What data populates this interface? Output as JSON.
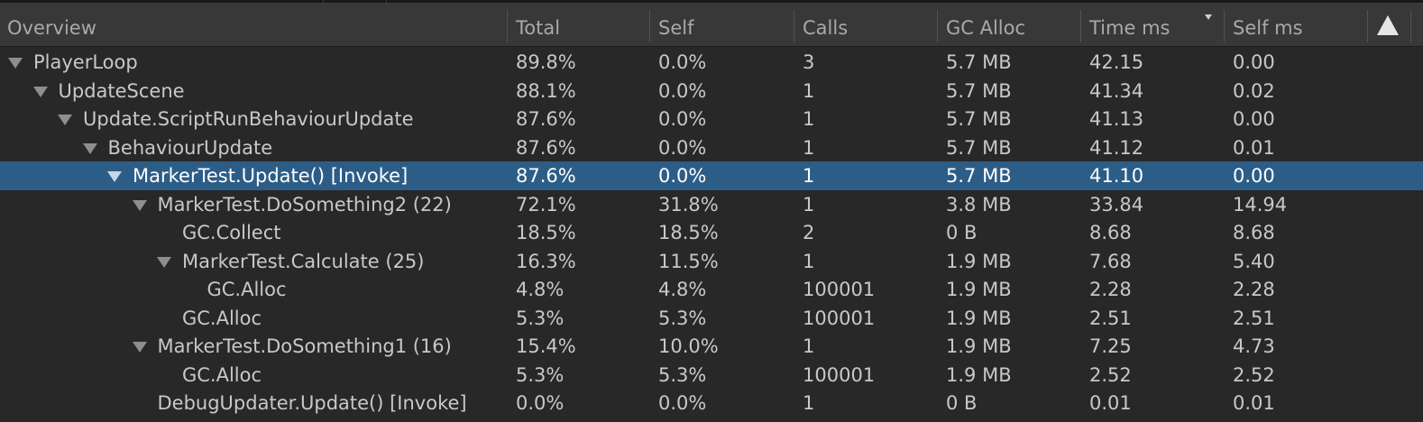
{
  "columns": [
    {
      "label": "Overview"
    },
    {
      "label": "Total"
    },
    {
      "label": "Self"
    },
    {
      "label": "Calls"
    },
    {
      "label": "GC Alloc"
    },
    {
      "label": "Time ms",
      "sorted": true,
      "sort_direction": "descending"
    },
    {
      "label": "Self ms"
    }
  ],
  "header_warning_icon": "warning-triangle-icon",
  "rows": [
    {
      "name": "PlayerLoop",
      "depth": 0,
      "expanded": true,
      "total": "89.8%",
      "self": "0.0%",
      "calls": "3",
      "gc_alloc": "5.7 MB",
      "time_ms": "42.15",
      "self_ms": "0.00"
    },
    {
      "name": "UpdateScene",
      "depth": 1,
      "expanded": true,
      "total": "88.1%",
      "self": "0.0%",
      "calls": "1",
      "gc_alloc": "5.7 MB",
      "time_ms": "41.34",
      "self_ms": "0.02"
    },
    {
      "name": "Update.ScriptRunBehaviourUpdate",
      "depth": 2,
      "expanded": true,
      "total": "87.6%",
      "self": "0.0%",
      "calls": "1",
      "gc_alloc": "5.7 MB",
      "time_ms": "41.13",
      "self_ms": "0.00"
    },
    {
      "name": "BehaviourUpdate",
      "depth": 3,
      "expanded": true,
      "total": "87.6%",
      "self": "0.0%",
      "calls": "1",
      "gc_alloc": "5.7 MB",
      "time_ms": "41.12",
      "self_ms": "0.01"
    },
    {
      "name": "MarkerTest.Update() [Invoke]",
      "depth": 4,
      "expanded": true,
      "selected": true,
      "total": "87.6%",
      "self": "0.0%",
      "calls": "1",
      "gc_alloc": "5.7 MB",
      "time_ms": "41.10",
      "self_ms": "0.00"
    },
    {
      "name": "MarkerTest.DoSomething2 (22)",
      "depth": 5,
      "expanded": true,
      "total": "72.1%",
      "self": "31.8%",
      "calls": "1",
      "gc_alloc": "3.8 MB",
      "time_ms": "33.84",
      "self_ms": "14.94"
    },
    {
      "name": "GC.Collect",
      "depth": 6,
      "expanded": false,
      "total": "18.5%",
      "self": "18.5%",
      "calls": "2",
      "gc_alloc": "0 B",
      "time_ms": "8.68",
      "self_ms": "8.68"
    },
    {
      "name": "MarkerTest.Calculate (25)",
      "depth": 6,
      "expanded": true,
      "total": "16.3%",
      "self": "11.5%",
      "calls": "1",
      "gc_alloc": "1.9 MB",
      "time_ms": "7.68",
      "self_ms": "5.40"
    },
    {
      "name": "GC.Alloc",
      "depth": 7,
      "expanded": false,
      "total": "4.8%",
      "self": "4.8%",
      "calls": "100001",
      "gc_alloc": "1.9 MB",
      "time_ms": "2.28",
      "self_ms": "2.28"
    },
    {
      "name": "GC.Alloc",
      "depth": 6,
      "expanded": false,
      "total": "5.3%",
      "self": "5.3%",
      "calls": "100001",
      "gc_alloc": "1.9 MB",
      "time_ms": "2.51",
      "self_ms": "2.51"
    },
    {
      "name": "MarkerTest.DoSomething1 (16)",
      "depth": 5,
      "expanded": true,
      "total": "15.4%",
      "self": "10.0%",
      "calls": "1",
      "gc_alloc": "1.9 MB",
      "time_ms": "7.25",
      "self_ms": "4.73"
    },
    {
      "name": "GC.Alloc",
      "depth": 6,
      "expanded": false,
      "total": "5.3%",
      "self": "5.3%",
      "calls": "100001",
      "gc_alloc": "1.9 MB",
      "time_ms": "2.52",
      "self_ms": "2.52"
    },
    {
      "name": "DebugUpdater.Update() [Invoke]",
      "depth": 5,
      "expanded": false,
      "total": "0.0%",
      "self": "0.0%",
      "calls": "1",
      "gc_alloc": "0 B",
      "time_ms": "0.01",
      "self_ms": "0.01"
    }
  ],
  "colors": {
    "background": "#282828",
    "header": "#383838",
    "selected_row": "#2c5d87"
  }
}
